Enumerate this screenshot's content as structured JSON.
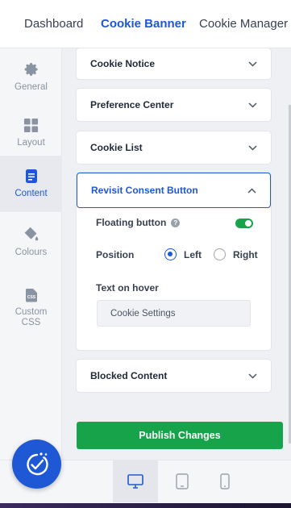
{
  "top_nav": {
    "tabs": [
      {
        "label": "Dashboard",
        "active": false
      },
      {
        "label": "Cookie Banner",
        "active": true
      },
      {
        "label": "Cookie Manager",
        "active": false
      }
    ]
  },
  "sidebar": {
    "items": [
      {
        "label": "General",
        "icon": "gear-icon",
        "active": false
      },
      {
        "label": "Layout",
        "icon": "grid-icon",
        "active": false
      },
      {
        "label": "Content",
        "icon": "document-icon",
        "active": true
      },
      {
        "label": "Colours",
        "icon": "paint-bucket-icon",
        "active": false
      },
      {
        "label": "Custom\nCSS",
        "icon": "css-file-icon",
        "active": false
      }
    ]
  },
  "sections": {
    "cookie_notice": "Cookie Notice",
    "preference_center": "Preference Center",
    "cookie_list": "Cookie List",
    "revisit_consent": "Revisit Consent Button",
    "blocked_content": "Blocked Content"
  },
  "revisit": {
    "floating_button_label": "Floating button",
    "floating_button_help": "?",
    "floating_button_on": true,
    "position_label": "Position",
    "position_options": [
      "Left",
      "Right"
    ],
    "position_selected": "Left",
    "hover_label": "Text on hover",
    "hover_value": "Cookie Settings"
  },
  "publish_label": "Publish Changes",
  "devices": [
    {
      "icon": "desktop-icon",
      "active": true
    },
    {
      "icon": "tablet-icon",
      "active": false
    },
    {
      "icon": "mobile-icon",
      "active": false
    }
  ],
  "colors": {
    "accent": "#1e58d4",
    "success": "#16a34a"
  }
}
